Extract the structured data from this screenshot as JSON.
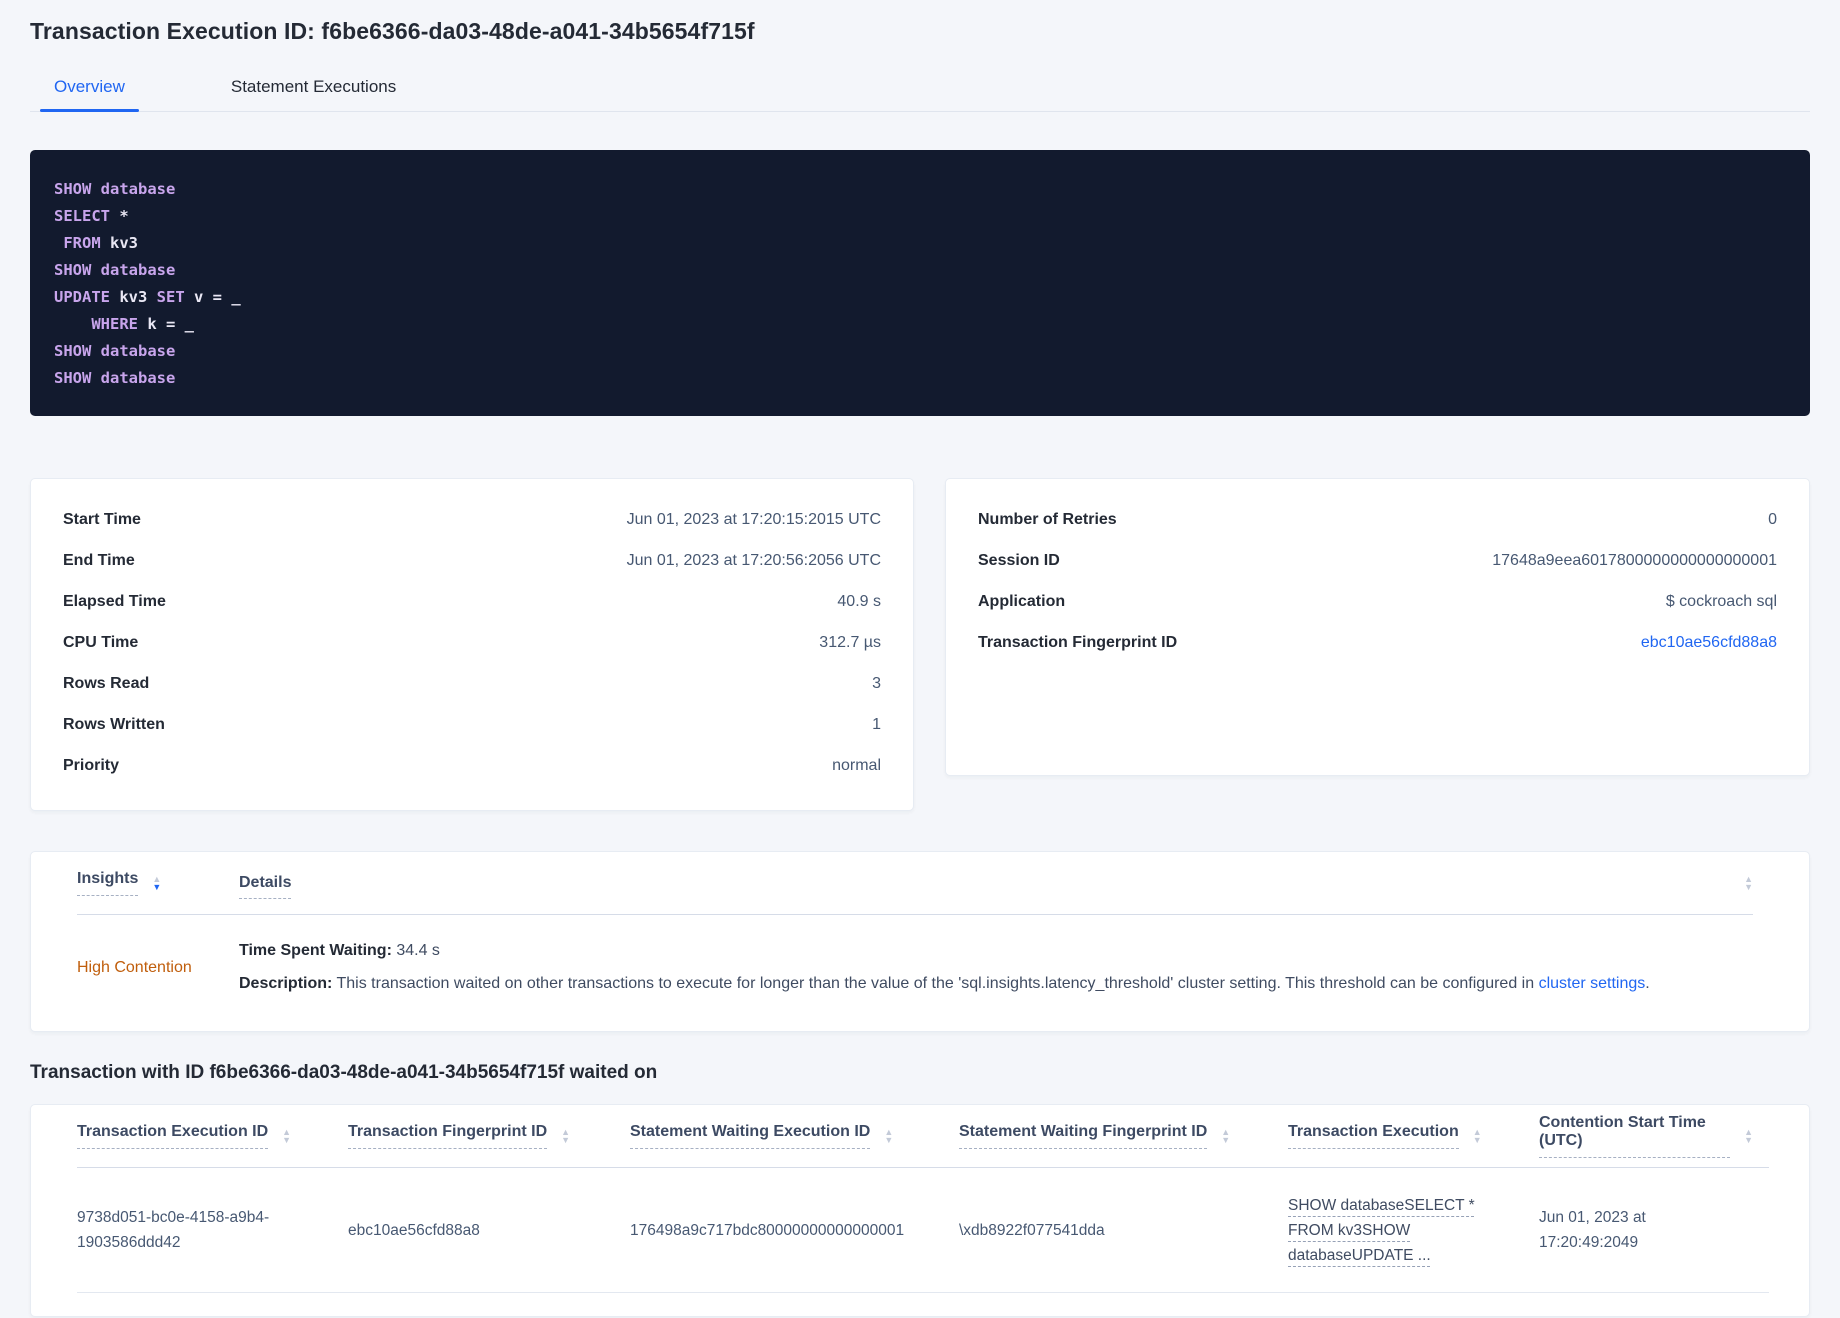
{
  "colors": {
    "accent_blue": "#2066f2",
    "warning_orange": "#c05e0c",
    "sql_keyword": "#c8a5ec",
    "sql_plain": "#e9e7f4",
    "sql_bg": "#121a2e"
  },
  "page": {
    "title": "Transaction Execution ID: f6be6366-da03-48de-a041-34b5654f715f"
  },
  "tabs": [
    {
      "label": "Overview",
      "active": true
    },
    {
      "label": "Statement Executions",
      "active": false
    }
  ],
  "sql": {
    "lines": [
      [
        {
          "text": "SHOW database",
          "type": "kw"
        }
      ],
      [
        {
          "text": "SELECT",
          "type": "kw"
        },
        {
          "text": " *",
          "type": "pl"
        }
      ],
      [
        {
          "text": " ",
          "type": "pl"
        },
        {
          "text": "FROM",
          "type": "kw"
        },
        {
          "text": " kv3",
          "type": "pl"
        }
      ],
      [
        {
          "text": "SHOW database",
          "type": "kw"
        }
      ],
      [
        {
          "text": "UPDATE",
          "type": "kw"
        },
        {
          "text": " kv3 ",
          "type": "pl"
        },
        {
          "text": "SET",
          "type": "kw"
        },
        {
          "text": " v = _",
          "type": "pl"
        }
      ],
      [
        {
          "text": "    ",
          "type": "pl"
        },
        {
          "text": "WHERE",
          "type": "kw"
        },
        {
          "text": " k = _",
          "type": "pl"
        }
      ],
      [
        {
          "text": "SHOW database",
          "type": "kw"
        }
      ],
      [
        {
          "text": "SHOW database",
          "type": "kw"
        }
      ]
    ]
  },
  "left_card": {
    "rows": [
      {
        "label": "Start Time",
        "value": "Jun 01, 2023 at 17:20:15:2015 UTC"
      },
      {
        "label": "End Time",
        "value": "Jun 01, 2023 at 17:20:56:2056 UTC"
      },
      {
        "label": "Elapsed Time",
        "value": "40.9 s"
      },
      {
        "label": "CPU Time",
        "value": "312.7 µs"
      },
      {
        "label": "Rows Read",
        "value": "3"
      },
      {
        "label": "Rows Written",
        "value": "1"
      },
      {
        "label": "Priority",
        "value": "normal"
      }
    ]
  },
  "right_card": {
    "rows": [
      {
        "label": "Number of Retries",
        "value": "0"
      },
      {
        "label": "Session ID",
        "value": "17648a9eea6017800000000000000001"
      },
      {
        "label": "Application",
        "value": "$ cockroach sql"
      },
      {
        "label": "Transaction Fingerprint ID",
        "value": "ebc10ae56cfd88a8",
        "link": true
      }
    ]
  },
  "insights": {
    "header": {
      "insights": "Insights",
      "details": "Details"
    },
    "row": {
      "insight": "High Contention",
      "time_label": "Time Spent Waiting:",
      "time_value": "34.4 s",
      "desc_label": "Description:",
      "desc_text": "This transaction waited on other transactions to execute for longer than the value of the 'sql.insights.latency_threshold' cluster setting. This threshold can be configured in ",
      "desc_link": "cluster settings",
      "desc_suffix": "."
    }
  },
  "waited_on": {
    "heading": "Transaction with ID f6be6366-da03-48de-a041-34b5654f715f waited on",
    "columns": [
      "Transaction Execution ID",
      "Transaction Fingerprint ID",
      "Statement Waiting Execution ID",
      "Statement Waiting Fingerprint ID",
      "Transaction Execution",
      "Contention Start Time (UTC)"
    ],
    "rows": [
      {
        "transaction_execution_id": "9738d051-bc0e-4158-a9b4-1903586ddd42",
        "transaction_fingerprint_id": "ebc10ae56cfd88a8",
        "statement_waiting_execution_id": "176498a9c717bdc80000000000000001",
        "statement_waiting_fingerprint_id": "\\xdb8922f077541dda",
        "transaction_execution": "SHOW databaseSELECT * FROM kv3SHOW databaseUPDATE ...",
        "contention_start_time": "Jun 01, 2023 at 17:20:49:2049"
      }
    ]
  }
}
